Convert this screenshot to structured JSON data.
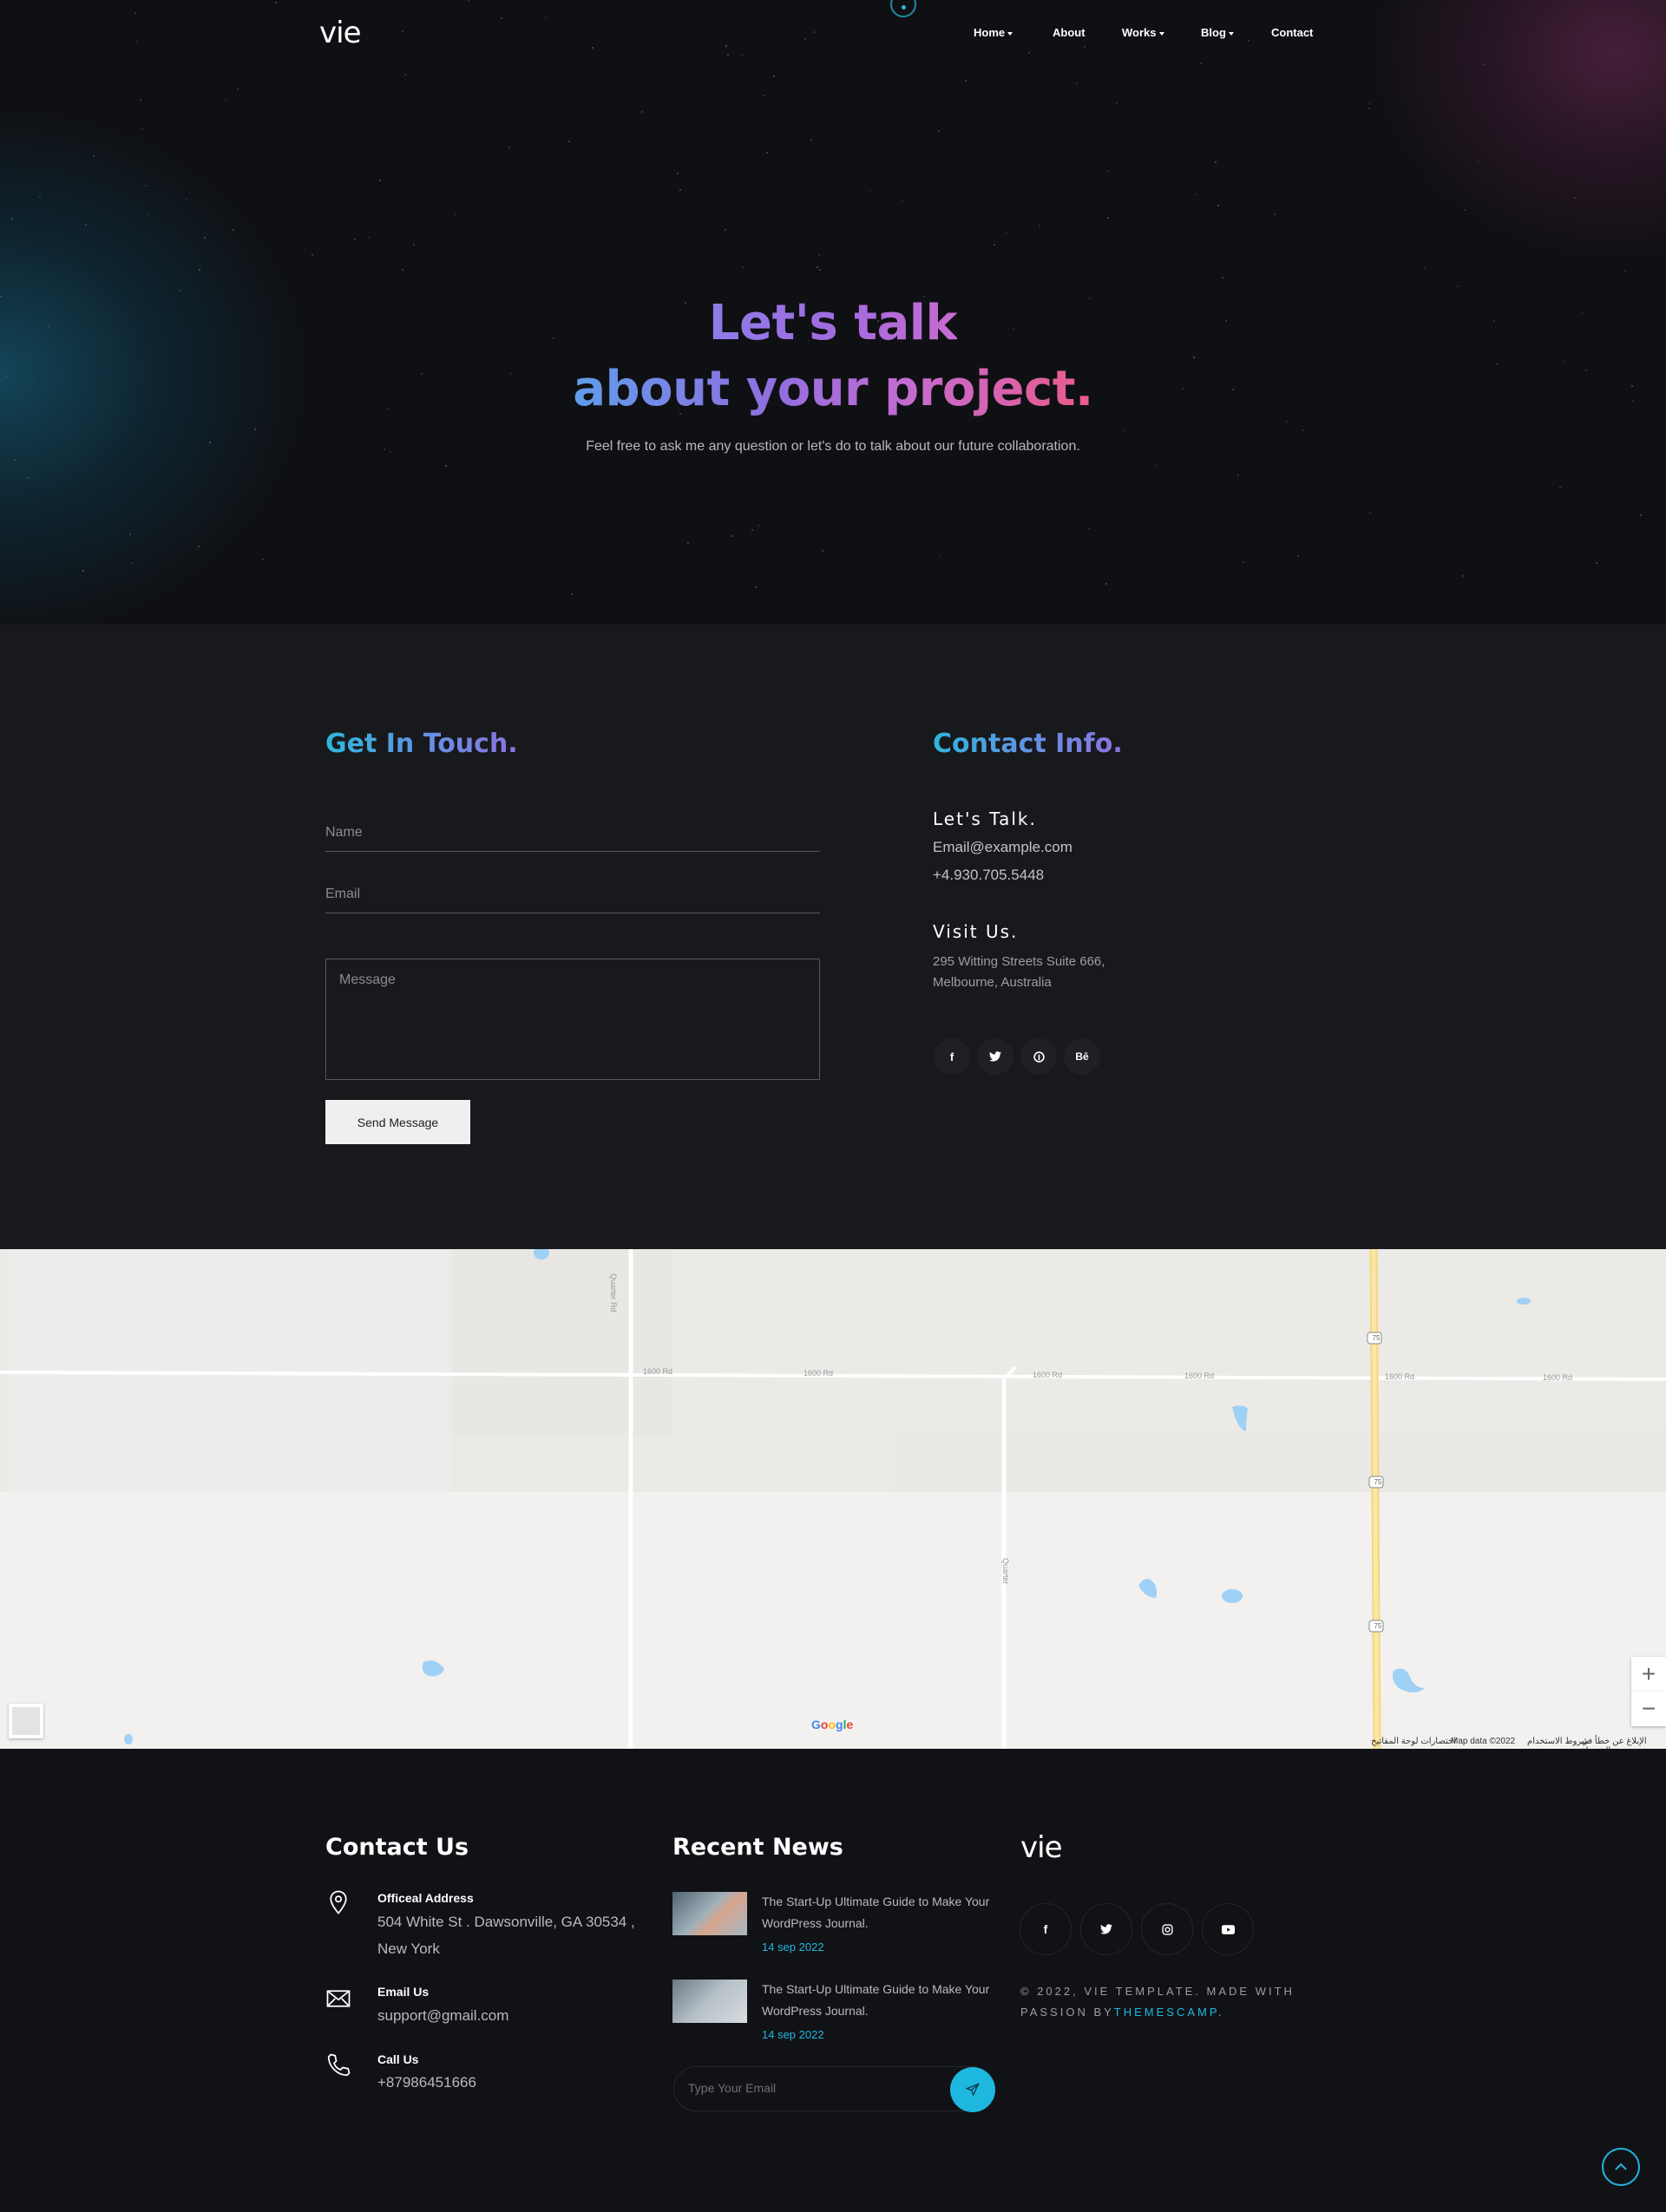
{
  "nav": {
    "logo": "vie",
    "items": [
      {
        "label": "Home",
        "dropdown": true
      },
      {
        "label": "About",
        "dropdown": false
      },
      {
        "label": "Works",
        "dropdown": true
      },
      {
        "label": "Blog",
        "dropdown": true
      },
      {
        "label": "Contact",
        "dropdown": false
      }
    ]
  },
  "hero": {
    "line1": "Let's talk",
    "line2": "about your project.",
    "subtitle": "Feel free to ask me any question or let's do to talk about our future collaboration."
  },
  "form": {
    "title": "Get In Touch.",
    "name_placeholder": "Name",
    "email_placeholder": "Email",
    "message_placeholder": "Message",
    "submit_label": "Send Message"
  },
  "contact_info": {
    "title": "Contact Info.",
    "talk_heading": "Let's Talk.",
    "email": "Email@example.com",
    "phone": "+4.930.705.5448",
    "visit_heading": "Visit Us.",
    "address_line1": "295 Witting Streets Suite 666,",
    "address_line2": "Melbourne, Australia",
    "socials": [
      "facebook-icon",
      "twitter-icon",
      "pinterest-icon",
      "behance-icon"
    ]
  },
  "map": {
    "roads": [
      "1600 Rd",
      "1600 Rd",
      "1600 Rd",
      "1600 Rd",
      "1600 Rd",
      "1600 Rd"
    ],
    "road_v1": "Quarter Rd",
    "road_v2": "Quarter",
    "highway": "75",
    "logo": "Google",
    "attrib_shortcuts": "اختصارات لوحة المفاتيح",
    "attrib_data": "Map data ©2022",
    "attrib_terms": "شروط الاستخدام",
    "attrib_report": "الإبلاغ عن خطأ في الخريطة",
    "zoom_in": "+",
    "zoom_out": "−"
  },
  "footer": {
    "contact_title": "Contact Us",
    "address_label": "Officeal Address",
    "address_line1": "504 White St . Dawsonville, GA 30534 ,",
    "address_line2": "New York",
    "email_label": "Email Us",
    "email": "support@gmail.com",
    "call_label": "Call Us",
    "phone": "+87986451666",
    "news_title": "Recent News",
    "news": [
      {
        "title": "The Start-Up Ultimate Guide to Make Your WordPress Journal.",
        "date": "14 sep 2022"
      },
      {
        "title": "The Start-Up Ultimate Guide to Make Your WordPress Journal.",
        "date": "14 sep 2022"
      }
    ],
    "subscribe_placeholder": "Type Your Email",
    "logo": "vie",
    "socials": [
      "facebook-icon",
      "twitter-icon",
      "instagram-icon",
      "youtube-icon"
    ],
    "copyright_prefix": "© 2022, VIE TEMPLATE. MADE WITH PASSION BY",
    "copyright_brand": "THEMESCAMP",
    "copyright_suffix": "."
  },
  "colors": {
    "accent": "#1db7e0",
    "background": "#18191d",
    "footer_bg": "#111216"
  }
}
